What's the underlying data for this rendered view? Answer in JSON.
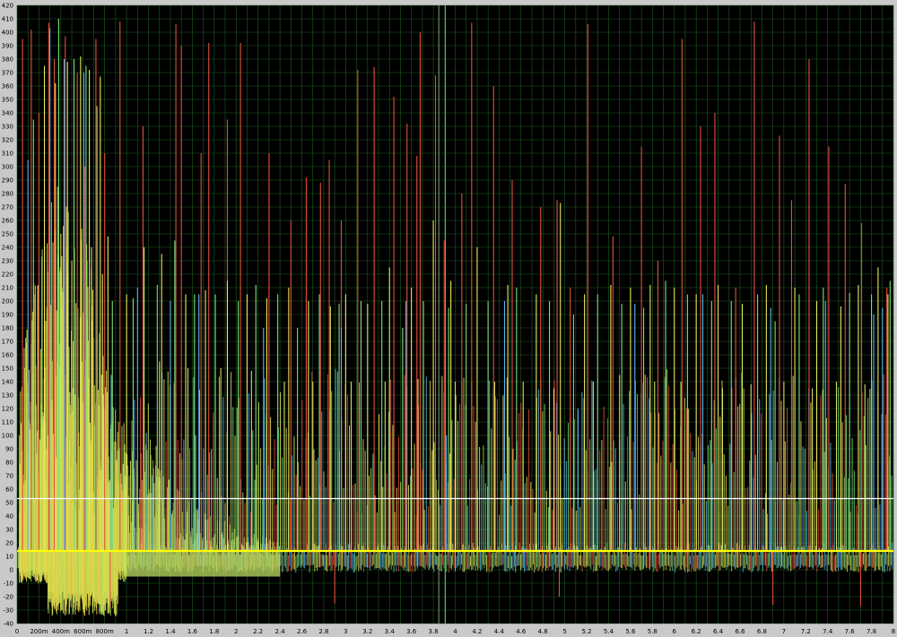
{
  "chart_data": {
    "type": "line",
    "title": "",
    "xlabel": "",
    "ylabel": "",
    "xlim": [
      0,
      8
    ],
    "ylim": [
      -40,
      420
    ],
    "grid": true,
    "y_ticks": [
      -40,
      -30,
      -20,
      -10,
      0,
      10,
      20,
      30,
      40,
      50,
      60,
      70,
      80,
      90,
      100,
      110,
      120,
      130,
      140,
      150,
      160,
      170,
      180,
      190,
      200,
      210,
      220,
      230,
      240,
      250,
      260,
      270,
      280,
      290,
      300,
      310,
      320,
      330,
      340,
      350,
      360,
      370,
      380,
      390,
      400,
      410,
      420
    ],
    "x_ticks": [
      {
        "v": 0,
        "label": "0"
      },
      {
        "v": 0.2,
        "label": "200m"
      },
      {
        "v": 0.4,
        "label": "400m"
      },
      {
        "v": 0.6,
        "label": "600m"
      },
      {
        "v": 0.8,
        "label": "800m"
      },
      {
        "v": 1,
        "label": "1"
      },
      {
        "v": 1.2,
        "label": "1.2"
      },
      {
        "v": 1.4,
        "label": "1.4"
      },
      {
        "v": 1.6,
        "label": "1.6"
      },
      {
        "v": 1.8,
        "label": "1.8"
      },
      {
        "v": 2,
        "label": "2"
      },
      {
        "v": 2.2,
        "label": "2.2"
      },
      {
        "v": 2.4,
        "label": "2.4"
      },
      {
        "v": 2.6,
        "label": "2.6"
      },
      {
        "v": 2.8,
        "label": "2.8"
      },
      {
        "v": 3,
        "label": "3"
      },
      {
        "v": 3.2,
        "label": "3.2"
      },
      {
        "v": 3.4,
        "label": "3.4"
      },
      {
        "v": 3.6,
        "label": "3.6"
      },
      {
        "v": 3.8,
        "label": "3.8"
      },
      {
        "v": 4,
        "label": "4"
      },
      {
        "v": 4.2,
        "label": "4.2"
      },
      {
        "v": 4.4,
        "label": "4.4"
      },
      {
        "v": 4.6,
        "label": "4.6"
      },
      {
        "v": 4.8,
        "label": "4.8"
      },
      {
        "v": 5,
        "label": "5"
      },
      {
        "v": 5.2,
        "label": "5.2"
      },
      {
        "v": 5.4,
        "label": "5.4"
      },
      {
        "v": 5.6,
        "label": "5.6"
      },
      {
        "v": 5.8,
        "label": "5.8"
      },
      {
        "v": 6,
        "label": "6"
      },
      {
        "v": 6.2,
        "label": "6.2"
      },
      {
        "v": 6.4,
        "label": "6.4"
      },
      {
        "v": 6.6,
        "label": "6.6"
      },
      {
        "v": 6.8,
        "label": "6.8"
      },
      {
        "v": 7,
        "label": "7"
      },
      {
        "v": 7.2,
        "label": "7.2"
      },
      {
        "v": 7.4,
        "label": "7.4"
      },
      {
        "v": 7.6,
        "label": "7.6"
      },
      {
        "v": 7.8,
        "label": "7.8"
      },
      {
        "v": 8,
        "label": "8"
      }
    ],
    "background_color": "#000000",
    "grid_color": "#1f5c1f",
    "series": [
      {
        "color": "#e0503a",
        "baseline": 14,
        "peaks": [
          [
            0.05,
            395
          ],
          [
            0.13,
            402
          ],
          [
            0.2,
            340
          ],
          [
            0.29,
            407
          ],
          [
            0.34,
            380
          ],
          [
            0.44,
            397
          ],
          [
            0.55,
            370
          ],
          [
            0.62,
            300
          ],
          [
            0.72,
            395
          ],
          [
            0.8,
            310
          ],
          [
            0.94,
            408
          ],
          [
            1.15,
            330
          ],
          [
            1.45,
            406
          ],
          [
            1.5,
            390
          ],
          [
            1.68,
            310
          ],
          [
            1.75,
            392
          ],
          [
            1.92,
            335
          ],
          [
            2.04,
            392
          ],
          [
            2.3,
            310
          ],
          [
            2.5,
            260
          ],
          [
            2.64,
            292
          ],
          [
            2.77,
            288
          ],
          [
            2.85,
            305
          ],
          [
            2.96,
            260
          ],
          [
            3.11,
            372
          ],
          [
            3.26,
            374
          ],
          [
            3.44,
            352
          ],
          [
            3.56,
            332
          ],
          [
            3.65,
            308
          ],
          [
            3.68,
            400
          ],
          [
            3.82,
            368
          ],
          [
            3.9,
            245
          ],
          [
            4.06,
            280
          ],
          [
            4.15,
            407
          ],
          [
            4.35,
            360
          ],
          [
            4.52,
            290
          ],
          [
            4.78,
            270
          ],
          [
            4.93,
            275
          ],
          [
            5.05,
            210
          ],
          [
            5.21,
            406
          ],
          [
            5.44,
            248
          ],
          [
            5.7,
            315
          ],
          [
            5.85,
            230
          ],
          [
            6.07,
            395
          ],
          [
            6.24,
            330
          ],
          [
            6.37,
            340
          ],
          [
            6.56,
            210
          ],
          [
            6.73,
            408
          ],
          [
            6.96,
            323
          ],
          [
            7.07,
            275
          ],
          [
            7.23,
            380
          ],
          [
            7.41,
            315
          ],
          [
            7.56,
            287
          ],
          [
            7.71,
            258
          ],
          [
            7.94,
            210
          ],
          [
            0.85,
            -28
          ],
          [
            2.9,
            -25
          ],
          [
            4.95,
            -20
          ],
          [
            6.9,
            -26
          ],
          [
            7.7,
            -27
          ]
        ]
      },
      {
        "color": "#e8e85a",
        "baseline": 14,
        "peaks": [
          [
            0.25,
            375
          ],
          [
            0.35,
            362
          ],
          [
            0.46,
            378
          ],
          [
            0.58,
            382
          ],
          [
            0.66,
            372
          ],
          [
            0.76,
            367
          ],
          [
            0.83,
            248
          ],
          [
            1.0,
            205
          ],
          [
            1.16,
            240
          ],
          [
            1.32,
            235
          ],
          [
            1.54,
            205
          ],
          [
            1.72,
            208
          ],
          [
            1.92,
            215
          ],
          [
            2.1,
            205
          ],
          [
            2.28,
            202
          ],
          [
            2.48,
            210
          ],
          [
            2.66,
            200
          ],
          [
            2.86,
            196
          ],
          [
            3.0,
            205
          ],
          [
            3.2,
            198
          ],
          [
            3.4,
            225
          ],
          [
            3.6,
            210
          ],
          [
            3.8,
            260
          ],
          [
            3.96,
            215
          ],
          [
            4.2,
            240
          ],
          [
            4.48,
            212
          ],
          [
            4.74,
            205
          ],
          [
            4.96,
            273
          ],
          [
            5.18,
            205
          ],
          [
            5.42,
            212
          ],
          [
            5.6,
            210
          ],
          [
            5.78,
            212
          ],
          [
            6.0,
            210
          ],
          [
            6.2,
            205
          ],
          [
            6.4,
            212
          ],
          [
            6.62,
            198
          ],
          [
            6.84,
            212
          ],
          [
            7.1,
            210
          ],
          [
            7.3,
            200
          ],
          [
            7.52,
            196
          ],
          [
            7.68,
            212
          ],
          [
            7.86,
            225
          ],
          [
            7.95,
            205
          ]
        ]
      },
      {
        "color": "#7be07b",
        "baseline": 14,
        "peaks": [
          [
            0.15,
            335
          ],
          [
            0.38,
            410
          ],
          [
            0.52,
            380
          ],
          [
            0.63,
            375
          ],
          [
            0.73,
            345
          ],
          [
            0.87,
            200
          ],
          [
            1.06,
            202
          ],
          [
            1.28,
            212
          ],
          [
            1.44,
            245
          ],
          [
            1.62,
            205
          ],
          [
            1.81,
            205
          ],
          [
            2.02,
            200
          ],
          [
            2.18,
            212
          ],
          [
            2.38,
            205
          ],
          [
            2.56,
            180
          ],
          [
            2.76,
            205
          ],
          [
            2.94,
            198
          ],
          [
            3.14,
            200
          ],
          [
            3.33,
            200
          ],
          [
            3.52,
            180
          ],
          [
            3.71,
            200
          ],
          [
            3.94,
            195
          ],
          [
            4.1,
            198
          ],
          [
            4.3,
            200
          ],
          [
            4.56,
            210
          ],
          [
            4.86,
            200
          ],
          [
            5.08,
            190
          ],
          [
            5.3,
            205
          ],
          [
            5.52,
            198
          ],
          [
            5.72,
            195
          ],
          [
            5.92,
            215
          ],
          [
            6.12,
            205
          ],
          [
            6.34,
            200
          ],
          [
            6.52,
            200
          ],
          [
            6.76,
            205
          ],
          [
            6.92,
            185
          ],
          [
            7.14,
            205
          ],
          [
            7.36,
            210
          ],
          [
            7.6,
            206
          ],
          [
            7.8,
            205
          ],
          [
            7.97,
            215
          ]
        ]
      },
      {
        "color": "#5ab8e8",
        "baseline": 14,
        "peaks": [
          [
            0.1,
            305
          ],
          [
            0.3,
            403
          ],
          [
            0.43,
            380
          ],
          [
            0.61,
            370
          ],
          [
            0.86,
            145
          ],
          [
            1.1,
            210
          ],
          [
            1.4,
            200
          ],
          [
            1.66,
            205
          ],
          [
            2.25,
            180
          ],
          [
            2.96,
            180
          ],
          [
            3.55,
            200
          ],
          [
            3.92,
            100
          ],
          [
            4.45,
            200
          ],
          [
            5.12,
            120
          ],
          [
            5.64,
            198
          ],
          [
            6.26,
            205
          ],
          [
            6.88,
            195
          ],
          [
            7.38,
            200
          ],
          [
            7.82,
            190
          ],
          [
            7.9,
            195
          ]
        ]
      },
      {
        "color": "#d0e060",
        "baseline": 14,
        "peaks": [
          [
            0.4,
            250
          ],
          [
            0.5,
            230
          ],
          [
            0.68,
            240
          ],
          [
            0.78,
            220
          ],
          [
            1.3,
            155
          ],
          [
            1.56,
            150
          ],
          [
            1.86,
            150
          ],
          [
            2.14,
            148
          ],
          [
            2.44,
            140
          ],
          [
            2.7,
            140
          ],
          [
            3.05,
            140
          ],
          [
            3.36,
            140
          ],
          [
            3.66,
            142
          ],
          [
            4.0,
            140
          ],
          [
            4.36,
            140
          ],
          [
            4.62,
            140
          ],
          [
            4.9,
            135
          ],
          [
            5.26,
            140
          ],
          [
            5.5,
            145
          ],
          [
            5.82,
            140
          ],
          [
            6.06,
            140
          ],
          [
            6.44,
            135
          ],
          [
            6.7,
            138
          ],
          [
            7.0,
            140
          ],
          [
            7.26,
            135
          ],
          [
            7.48,
            140
          ],
          [
            7.74,
            138
          ]
        ]
      }
    ],
    "horizontal_lines": [
      {
        "y": 53,
        "color": "#ffffff"
      },
      {
        "y": 14,
        "color": "#ffff00"
      }
    ],
    "vertical_lines": [
      {
        "x": 3.85,
        "color": "#7fa07f"
      },
      {
        "x": 3.91,
        "color": "#7fa07f"
      }
    ]
  }
}
